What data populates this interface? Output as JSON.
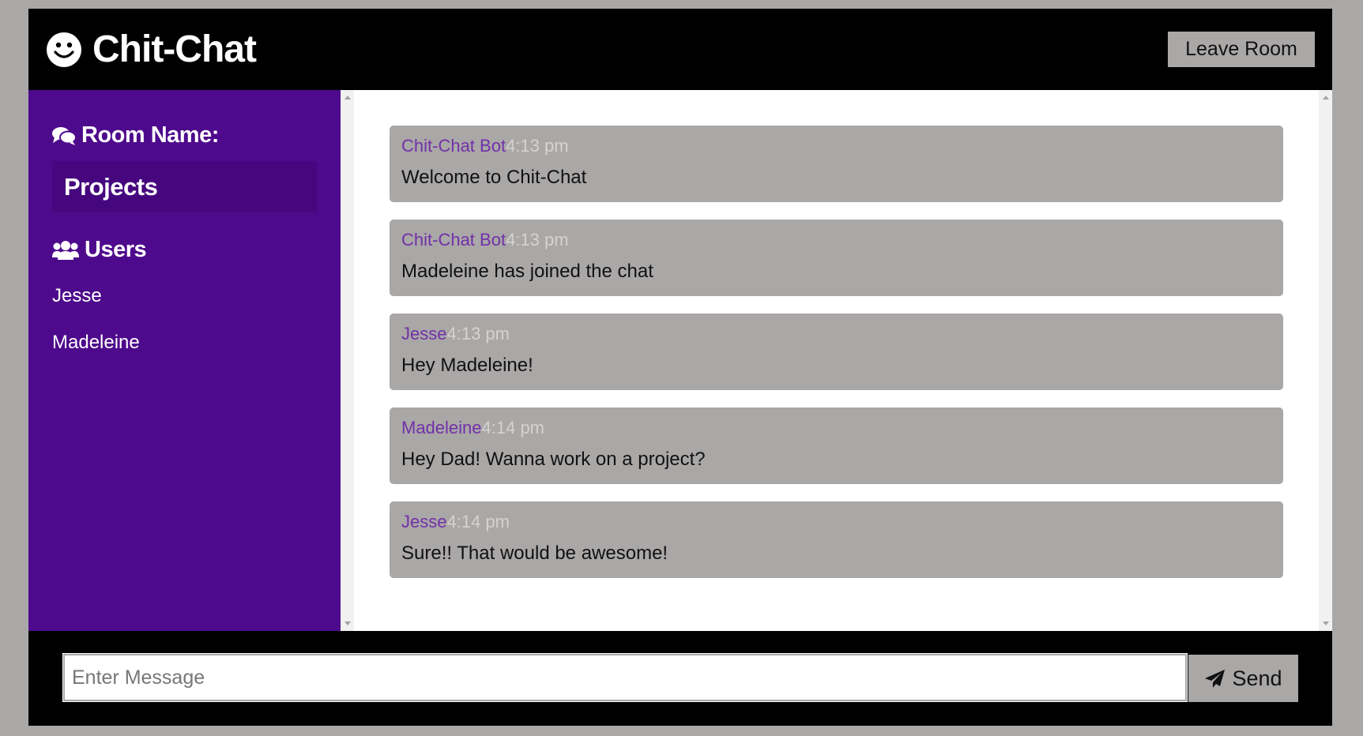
{
  "header": {
    "app_title": "Chit-Chat",
    "logo_icon": "smiley-face-icon",
    "leave_button_label": "Leave Room"
  },
  "sidebar": {
    "room_heading": "Room Name:",
    "room_icon": "comments-icon",
    "room_name": "Projects",
    "users_heading": "Users",
    "users_icon": "users-icon",
    "users": [
      "Jesse",
      "Madeleine"
    ]
  },
  "messages": [
    {
      "author": "Chit-Chat Bot",
      "time": "4:13 pm",
      "text": "Welcome to Chit-Chat"
    },
    {
      "author": "Chit-Chat Bot",
      "time": "4:13 pm",
      "text": "Madeleine has joined the chat"
    },
    {
      "author": "Jesse",
      "time": "4:13 pm",
      "text": "Hey Madeleine!"
    },
    {
      "author": "Madeleine",
      "time": "4:14 pm",
      "text": "Hey Dad! Wanna work on a project?"
    },
    {
      "author": "Jesse",
      "time": "4:14 pm",
      "text": "Sure!! That would be awesome!"
    }
  ],
  "composer": {
    "input_value": "",
    "placeholder": "Enter Message",
    "send_label": "Send",
    "send_icon": "paper-plane-icon"
  },
  "colors": {
    "sidebar_bg": "#4e0a8c",
    "room_box_bg": "#46077e",
    "message_bg": "#aaa7a7",
    "author_color": "#7131a8",
    "time_color": "#d6d2d2",
    "button_bg": "#aaa7a7"
  }
}
